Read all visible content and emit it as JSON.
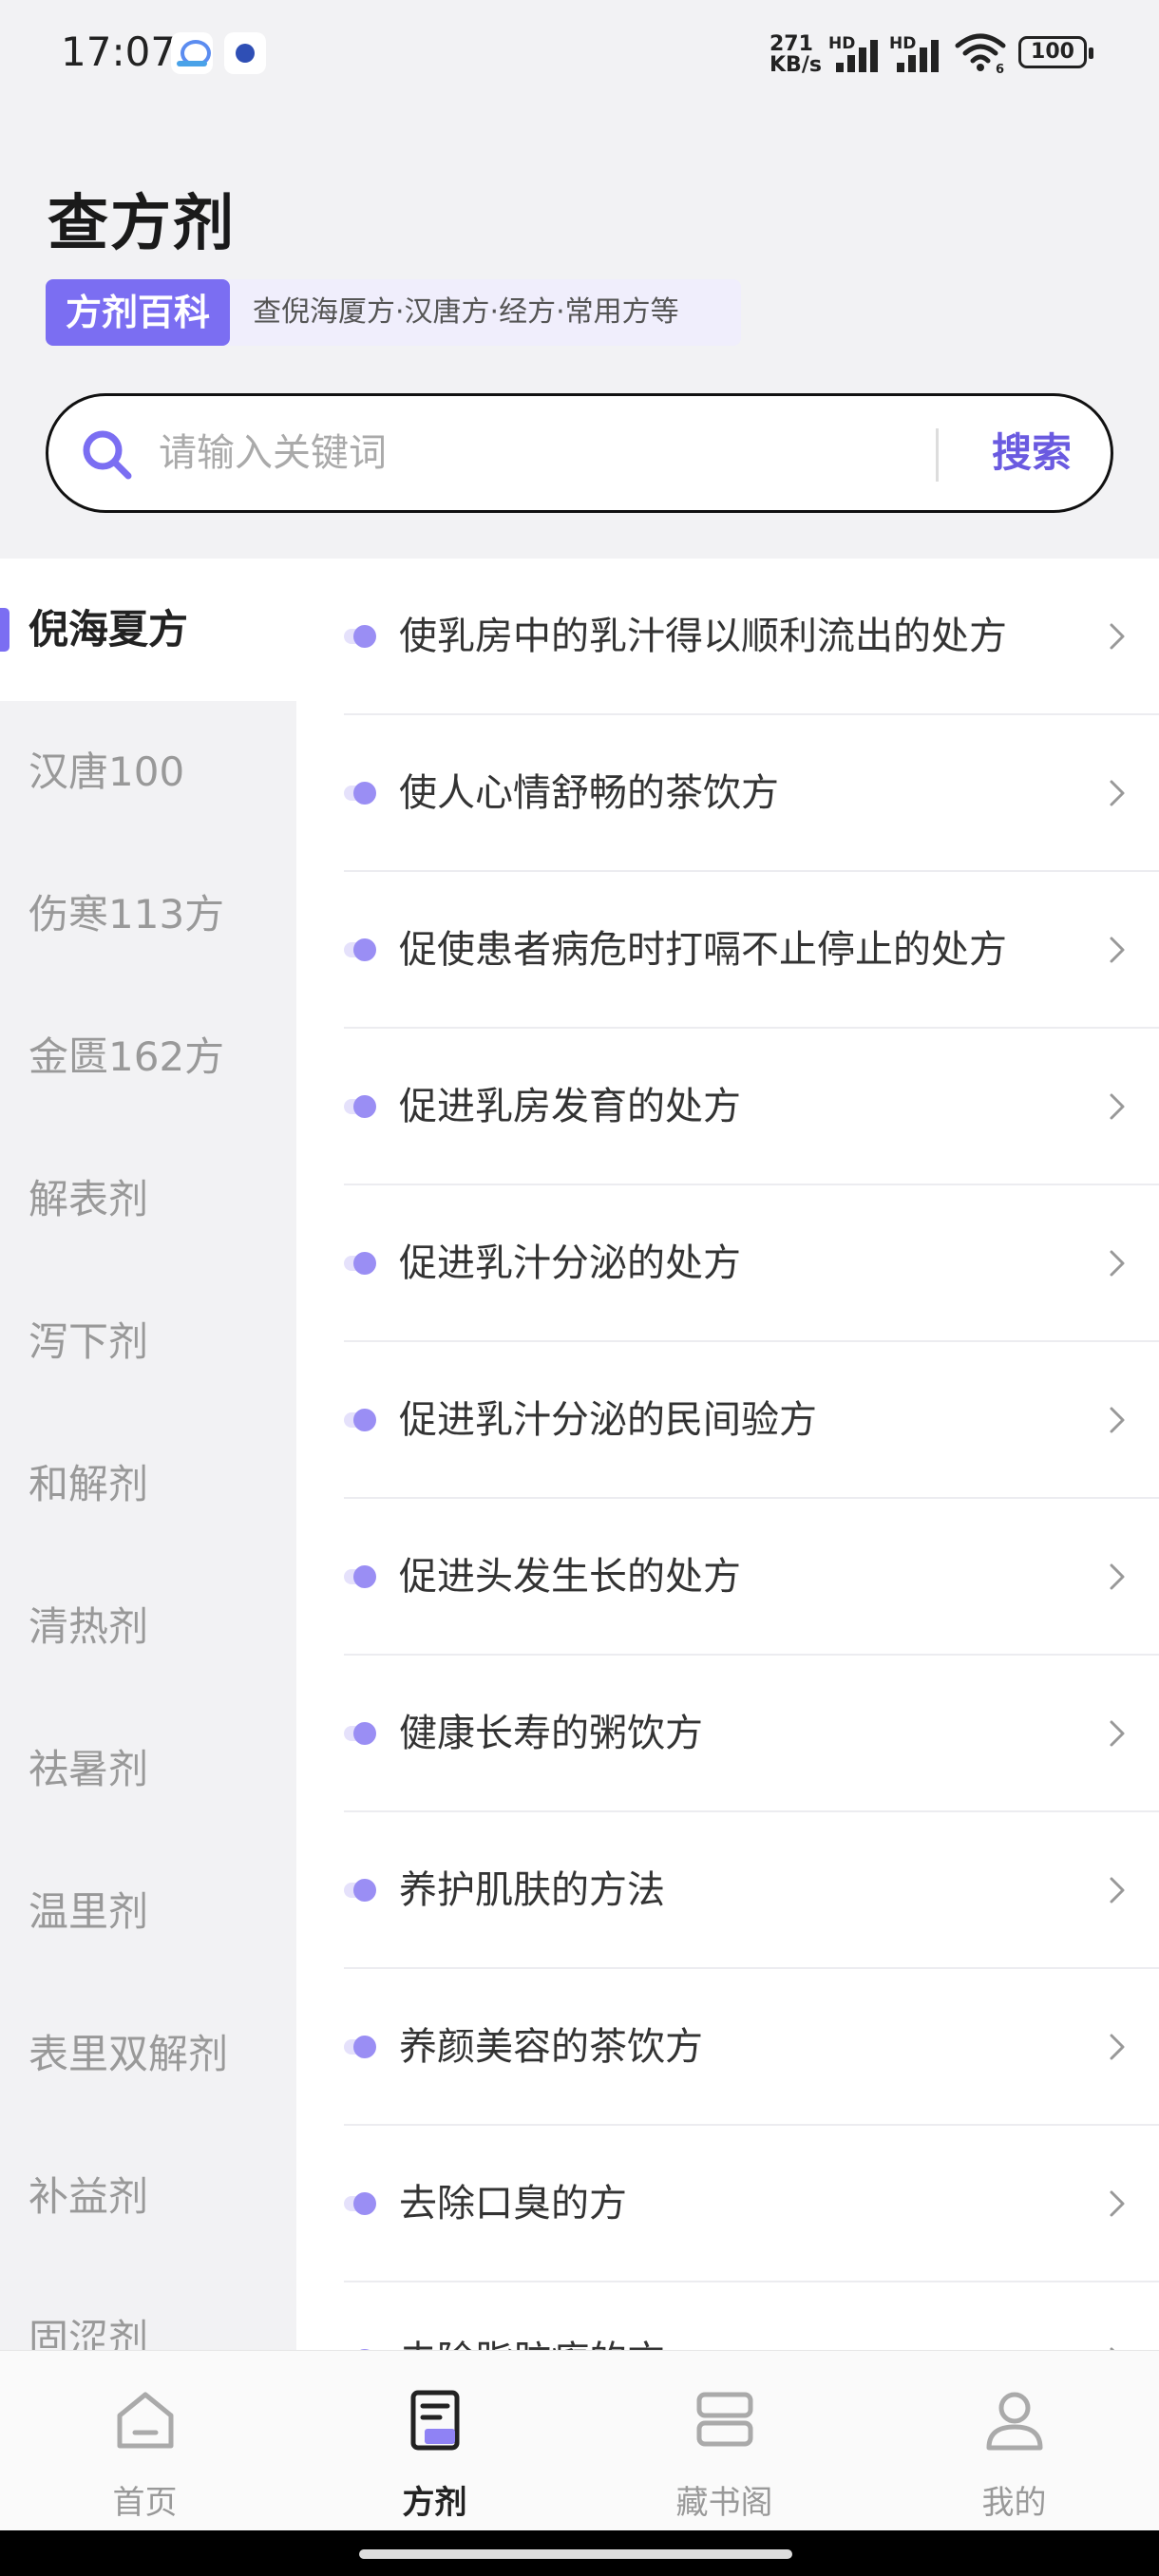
{
  "status_bar": {
    "time": "17:07",
    "network_speed_value": "271",
    "network_speed_unit": "KB/s",
    "signal_label": "HD",
    "wifi_label": "6",
    "battery": "100"
  },
  "header": {
    "title": "查方剂",
    "badge": "方剂百科",
    "description": "查倪海厦方·汉唐方·经方·常用方等"
  },
  "search": {
    "placeholder": "请输入关键词",
    "value": "",
    "button_label": "搜索"
  },
  "sidebar": {
    "items": [
      {
        "label": "倪海夏方",
        "active": true
      },
      {
        "label": "汉唐100"
      },
      {
        "label": "伤寒113方"
      },
      {
        "label": "金匮162方"
      },
      {
        "label": "解表剂"
      },
      {
        "label": "泻下剂"
      },
      {
        "label": "和解剂"
      },
      {
        "label": "清热剂"
      },
      {
        "label": "祛暑剂"
      },
      {
        "label": "温里剂"
      },
      {
        "label": "表里双解剂"
      },
      {
        "label": "补益剂"
      },
      {
        "label": "固涩剂"
      }
    ]
  },
  "list": {
    "items": [
      "使乳房中的乳汁得以顺利流出的处方",
      "使人心情舒畅的茶饮方",
      "促使患者病危时打嗝不止停止的处方",
      "促进乳房发育的处方",
      "促进乳汁分泌的处方",
      "促进乳汁分泌的民间验方",
      "促进头发生长的处方",
      "健康长寿的粥饮方",
      "养护肌肤的方法",
      "养颜美容的茶饮方",
      "去除口臭的方",
      "去除脂肪瘤的方"
    ]
  },
  "bottom_nav": {
    "items": [
      {
        "label": "首页",
        "icon": "home-icon"
      },
      {
        "label": "方剂",
        "icon": "prescription-icon",
        "active": true
      },
      {
        "label": "藏书阁",
        "icon": "library-icon"
      },
      {
        "label": "我的",
        "icon": "profile-icon"
      }
    ]
  },
  "colors": {
    "accent": "#7b6ef2",
    "search_button": "#6a5ae0",
    "background": "#f2f2f4"
  }
}
